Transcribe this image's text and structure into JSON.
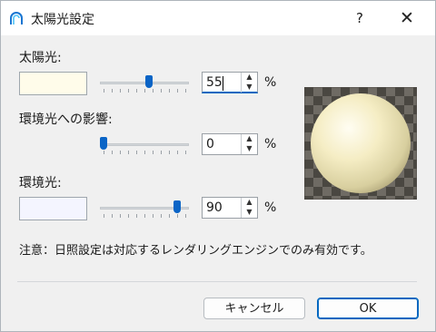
{
  "window": {
    "title": "太陽光設定",
    "help_label": "?",
    "close_label": "✕"
  },
  "sunlight": {
    "label": "太陽光:",
    "swatch_color": "#fffcea",
    "slider_value": 55,
    "value": "55",
    "unit": "%"
  },
  "ambient_influence": {
    "label": "環境光への影響:",
    "slider_value": 0,
    "value": "0",
    "unit": "%"
  },
  "ambient": {
    "label": "環境光:",
    "swatch_color": "#f4f5ff",
    "slider_value": 90,
    "value": "90",
    "unit": "%"
  },
  "note": "注意：日照設定は対応するレンダリングエンジンでのみ有効です。",
  "buttons": {
    "cancel": "キャンセル",
    "ok": "OK"
  },
  "icons": {
    "app": "app-icon",
    "spin_up": "▲",
    "spin_down": "▼"
  }
}
